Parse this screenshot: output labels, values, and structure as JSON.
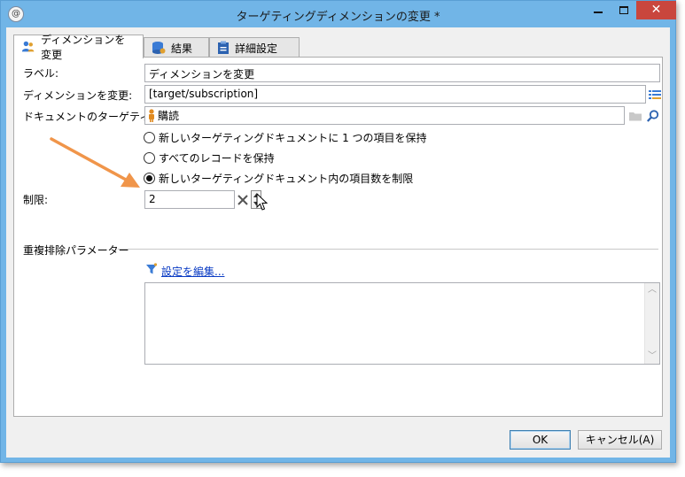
{
  "window": {
    "title": "ターゲティングディメンションの変更 *",
    "app_icon": "@"
  },
  "tabs": [
    {
      "label": "ディメンションを変更",
      "icon": "users-icon"
    },
    {
      "label": "結果",
      "icon": "database-icon"
    },
    {
      "label": "詳細設定",
      "icon": "clipboard-icon"
    }
  ],
  "form": {
    "label_caption": "ラベル:",
    "label_value": "ディメンションを変更",
    "dimension_caption": "ディメンションを変更:",
    "dimension_value": "[target/subscription]",
    "doc_target_caption": "ドキュメントのターゲティング:",
    "doc_target_value": "購読",
    "radio_options": [
      {
        "label": "新しいターゲティングドキュメントに 1 つの項目を保持",
        "checked": false
      },
      {
        "label": "すべてのレコードを保持",
        "checked": false
      },
      {
        "label": "新しいターゲティングドキュメント内の項目数を制限",
        "checked": true
      }
    ],
    "limit_caption": "制限:",
    "limit_value": "2",
    "dedup_caption": "重複排除パラメーター",
    "edit_settings_link": "設定を編集..."
  },
  "buttons": {
    "ok": "OK",
    "cancel": "キャンセル(A)"
  },
  "colors": {
    "title_bar": "#71b5e7",
    "close_button": "#c9463d",
    "annotation_arrow": "#f0954a",
    "link": "#0b3cc4"
  }
}
